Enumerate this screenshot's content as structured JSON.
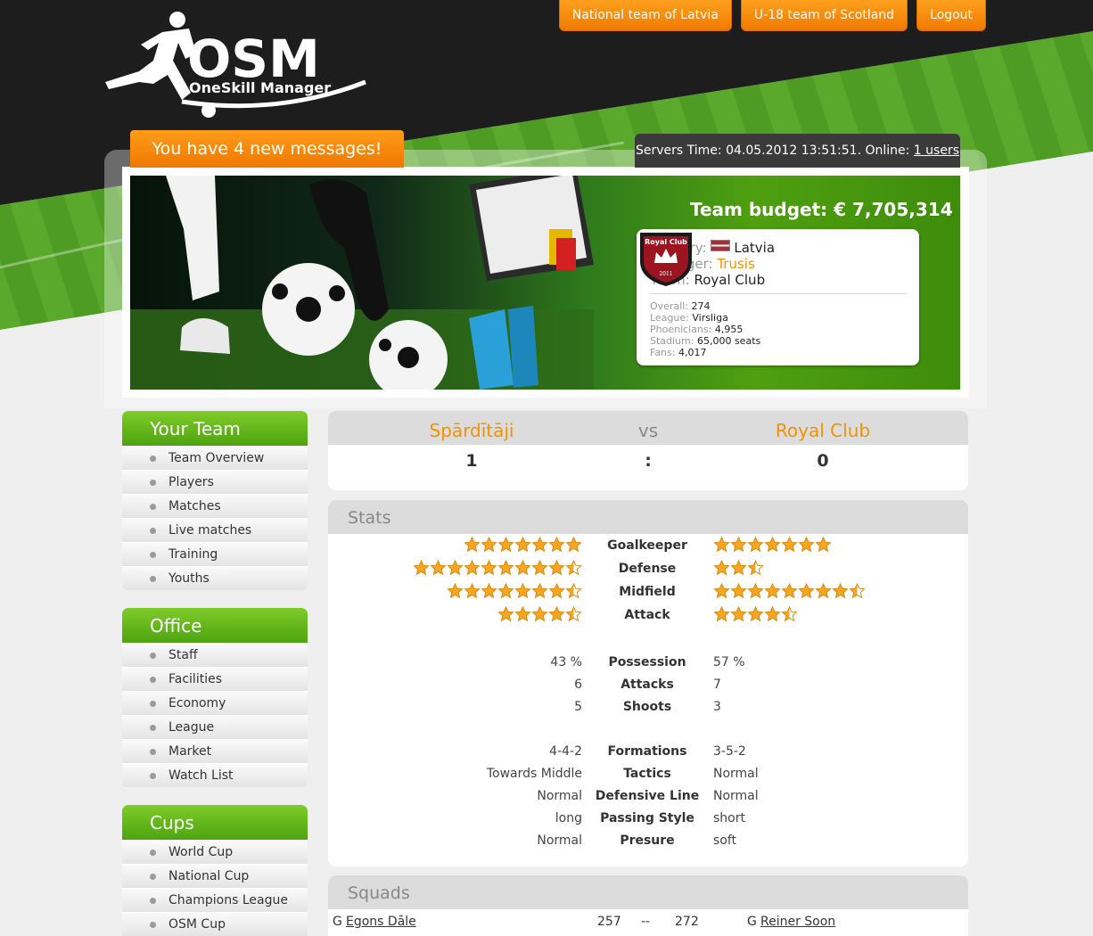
{
  "topnav": {
    "national": "National team of Latvia",
    "u18": "U-18 team of Scotland",
    "logout": "Logout"
  },
  "logo": {
    "title": "OSM",
    "subtitle": "OneSkill Manager"
  },
  "messages": "You have 4 new messages!",
  "server": {
    "prefix": "Servers Time: 04.05.2012 13:51:51. Online: ",
    "online": "1 users"
  },
  "banner": {
    "budget": "Team budget: € 7,705,314",
    "country_label": "Country:",
    "country": "Latvia",
    "manager_label": "Manager:",
    "manager": "Trusis",
    "team_label": "Team:",
    "team": "Royal Club",
    "crest_text": "Royal Club",
    "crest_year": "2011",
    "stats": [
      {
        "label": "Overall:",
        "value": "274"
      },
      {
        "label": "League:",
        "value": "Virsliga"
      },
      {
        "label": "Phoenicians:",
        "value": "4,955"
      },
      {
        "label": "Stadium:",
        "value": "65,000 seats"
      },
      {
        "label": "Fans:",
        "value": "4,017"
      }
    ]
  },
  "sidebar": [
    {
      "title": "Your Team",
      "items": [
        "Team Overview",
        "Players",
        "Matches",
        "Live matches",
        "Training",
        "Youths"
      ]
    },
    {
      "title": "Office",
      "items": [
        "Staff",
        "Facilities",
        "Economy",
        "League",
        "Market",
        "Watch List"
      ]
    },
    {
      "title": "Cups",
      "items": [
        "World Cup",
        "National Cup",
        "Champions League",
        "OSM Cup"
      ]
    }
  ],
  "match": {
    "home": "Spārdītāji",
    "vs": "vs",
    "away": "Royal Club",
    "home_score": "1",
    "sep": ":",
    "away_score": "0"
  },
  "stats": {
    "title": "Stats",
    "ratings": [
      {
        "label": "Goalkeeper",
        "home": 7,
        "away": 7
      },
      {
        "label": "Defense",
        "home": 9.5,
        "away": 2.5
      },
      {
        "label": "Midfield",
        "home": 7.5,
        "away": 8.5
      },
      {
        "label": "Attack",
        "home": 4.5,
        "away": 4.5
      }
    ],
    "rows": [
      {
        "label": "Possession",
        "home": "43 %",
        "away": "57 %"
      },
      {
        "label": "Attacks",
        "home": "6",
        "away": "7"
      },
      {
        "label": "Shoots",
        "home": "5",
        "away": "3"
      },
      {
        "label": "Formations",
        "home": "4-4-2",
        "away": "3-5-2"
      },
      {
        "label": "Tactics",
        "home": "Towards Middle",
        "away": "Normal"
      },
      {
        "label": "Defensive Line",
        "home": "Normal",
        "away": "Normal"
      },
      {
        "label": "Passing Style",
        "home": "long",
        "away": "short"
      },
      {
        "label": "Presure",
        "home": "Normal",
        "away": "soft"
      }
    ]
  },
  "squads": {
    "title": "Squads",
    "rows": [
      {
        "home_pos": "G",
        "home_name": "Egons Dāle",
        "home_val": "257",
        "sep": "--",
        "away_val": "272",
        "away_pos": "G",
        "away_name": "Reiner Soon"
      }
    ]
  },
  "colors": {
    "accent": "#f39200",
    "green": "#5cb31a",
    "dark": "#1b1b1b"
  }
}
